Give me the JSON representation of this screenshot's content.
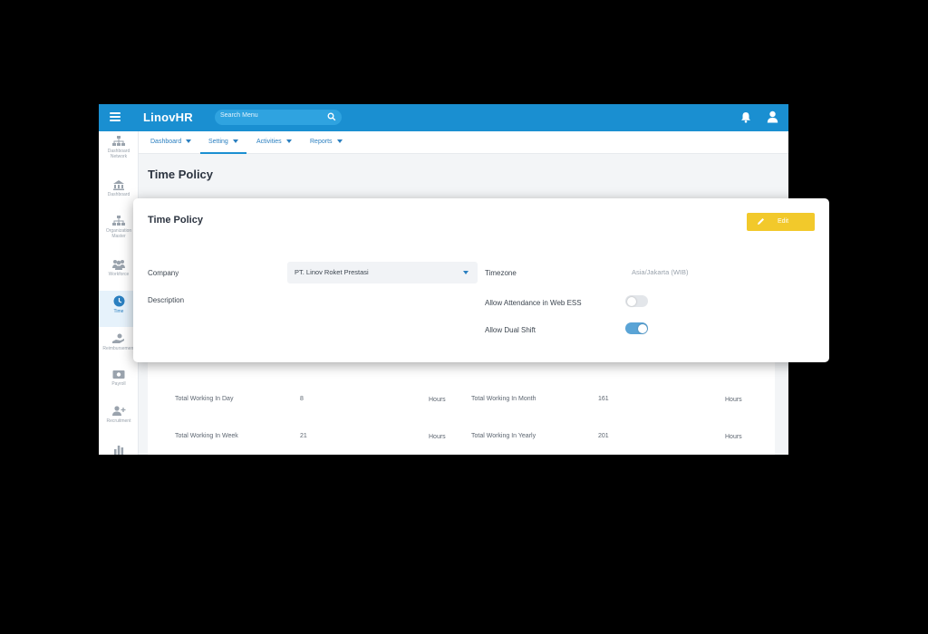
{
  "app": {
    "logo": "LinovHR",
    "search_placeholder": "Search Menu",
    "page_title": "Time Policy"
  },
  "nav": {
    "tabs": [
      {
        "label": "Dashboard"
      },
      {
        "label": "Setting"
      },
      {
        "label": "Activities"
      },
      {
        "label": "Reports"
      }
    ],
    "active_tab": "Setting"
  },
  "sidebar": {
    "items": [
      {
        "label": "Dashboard Network",
        "icon": "org-chart-icon"
      },
      {
        "label": "Dashboard",
        "icon": "building-icon"
      },
      {
        "label": "Organization Master",
        "icon": "org-chart-icon"
      },
      {
        "label": "Workforce",
        "icon": "people-icon"
      },
      {
        "label": "Time",
        "icon": "clock-icon"
      },
      {
        "label": "Reimbursement",
        "icon": "hand-coin-icon"
      },
      {
        "label": "Payroll",
        "icon": "money-icon"
      },
      {
        "label": "Recruitment",
        "icon": "add-user-icon"
      },
      {
        "label": "",
        "icon": "bar-chart-icon"
      }
    ],
    "active_item": "Time"
  },
  "background_card": {
    "rows": [
      {
        "left_label": "Total Working In Day",
        "left_value": "8",
        "left_unit": "Hours",
        "right_label": "Total Working In Month",
        "right_value": "161",
        "right_unit": "Hours"
      },
      {
        "left_label": "Total Working In Week",
        "left_value": "21",
        "left_unit": "Hours",
        "right_label": "Total Working In Yearly",
        "right_value": "201",
        "right_unit": "Hours"
      }
    ]
  },
  "card": {
    "title": "Time Policy",
    "edit_label": "Edit",
    "company_label": "Company",
    "company_value": "PT. Linov Roket Prestasi",
    "description_label": "Description",
    "timezone_label": "Timezone",
    "timezone_value": "Asia/Jakarta (WIB)",
    "allow_web_ess_label": "Allow Attendance in Web ESS",
    "allow_web_ess_on": false,
    "allow_dual_shift_label": "Allow Dual Shift",
    "allow_dual_shift_on": true
  },
  "colors": {
    "brand_blue": "#1a8fd1",
    "edit_yellow": "#f2c92b",
    "toggle_on": "#5aa4d6"
  }
}
